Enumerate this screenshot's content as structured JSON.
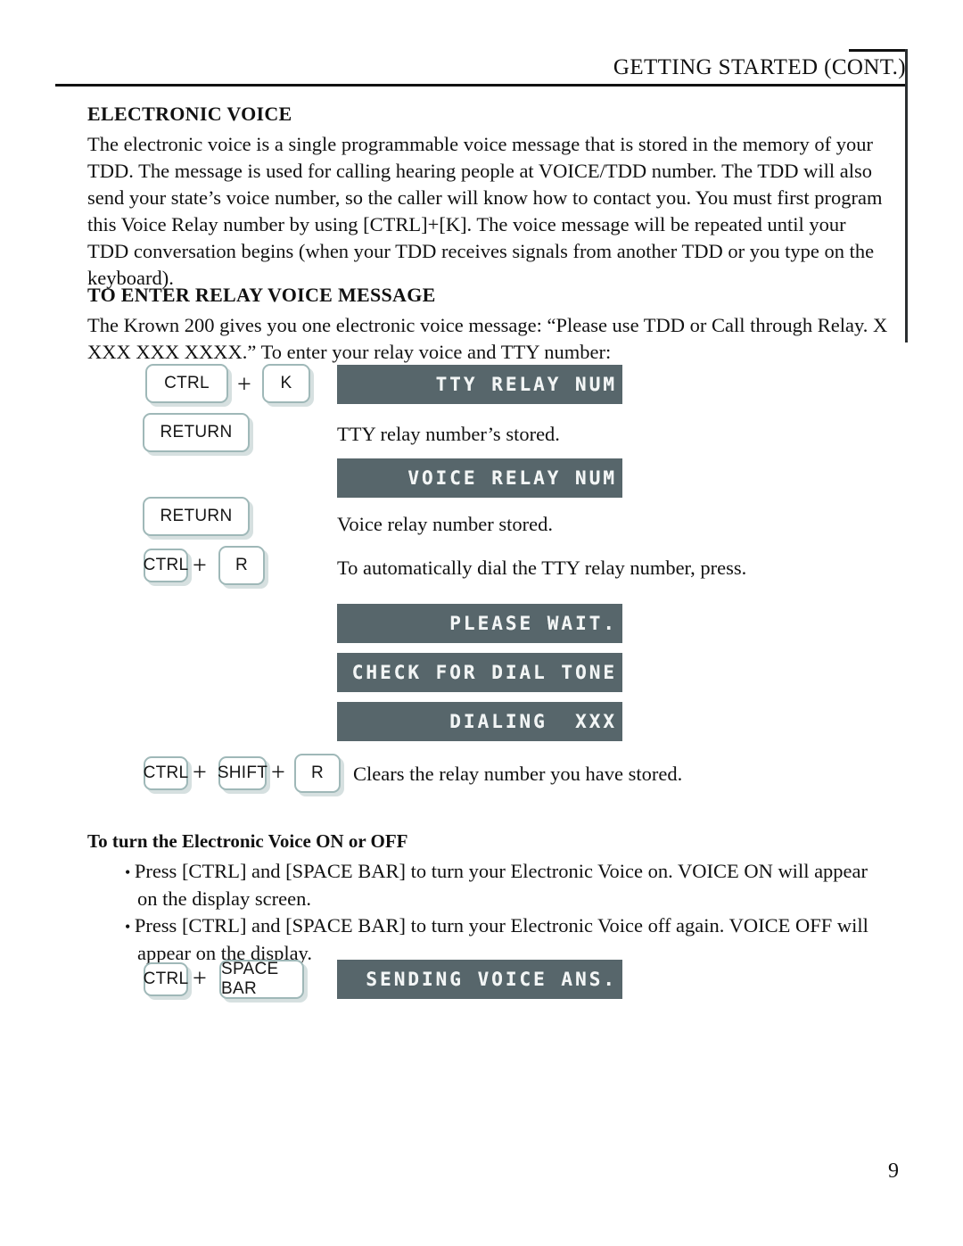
{
  "header": {
    "title_main": "GETTING STARTED (C",
    "title_full": "GETTING STARTED (CONT.)",
    "title_lead": "GETTING STARTED (C",
    "title_tail": "ONT.)"
  },
  "sections": {
    "electronic_voice": {
      "heading": "ELECTRONIC VOICE",
      "paragraph": "The electronic voice is a single programmable voice message that is stored in the memory of your TDD. The message is used for calling hearing people at VOICE/TDD number. The TDD will also send your state’s voice number, so the caller will know how to contact you. You must first program this Voice Relay number by using [CTRL]+[K]. The voice message will be repeated until your TDD conversation begins (when your TDD receives signals from another TDD or you type on the keyboard)."
    },
    "relay_voice_message": {
      "heading": "TO ENTER RELAY VOICE MESSAGE",
      "paragraph": "The Krown 200 gives you one electronic voice message: “Please use TDD or Call through Relay. X XXX XXX XXXX.” To enter your relay voice and TTY number:"
    },
    "voice_on_off": {
      "heading": "To turn the Electronic Voice ON or OFF",
      "bullets": [
        "Press [CTRL] and [SPACE BAR] to turn your Electronic Voice on. VOICE ON will appear on the display screen.",
        "Press [CTRL] and [SPACE BAR] to turn your Electronic Voice off again. VOICE OFF will appear on the display."
      ]
    }
  },
  "keys": {
    "ctrl": "CTRL",
    "k": "K",
    "r": "R",
    "return": "RETURN",
    "shift": "SHIFT",
    "space_bar": "SPACE BAR",
    "plus": "+"
  },
  "displays": {
    "tty_relay_num": "TTY RELAY NUM",
    "voice_relay_num": "VOICE RELAY NUM",
    "please_wait": "PLEASE WAIT.",
    "check_for_dial_tone": "CHECK FOR DIAL TONE",
    "dialing": "DIALING  XXX",
    "sending_voice_ans": "SENDING VOICE ANS."
  },
  "captions": {
    "tty_stored": "TTY relay number’s stored.",
    "voice_stored": "Voice relay number stored.",
    "auto_dial": "To automatically dial the TTY relay number, press.",
    "clears_relay": "Clears the relay number you have stored."
  },
  "footer": {
    "page_number": "9"
  },
  "colors": {
    "lcd_background": "#57666b",
    "lcd_text": "#f2f5f5",
    "key_border": "#9fb8b8",
    "key_shadow": "#d6e0e0",
    "rule": "#111111"
  }
}
